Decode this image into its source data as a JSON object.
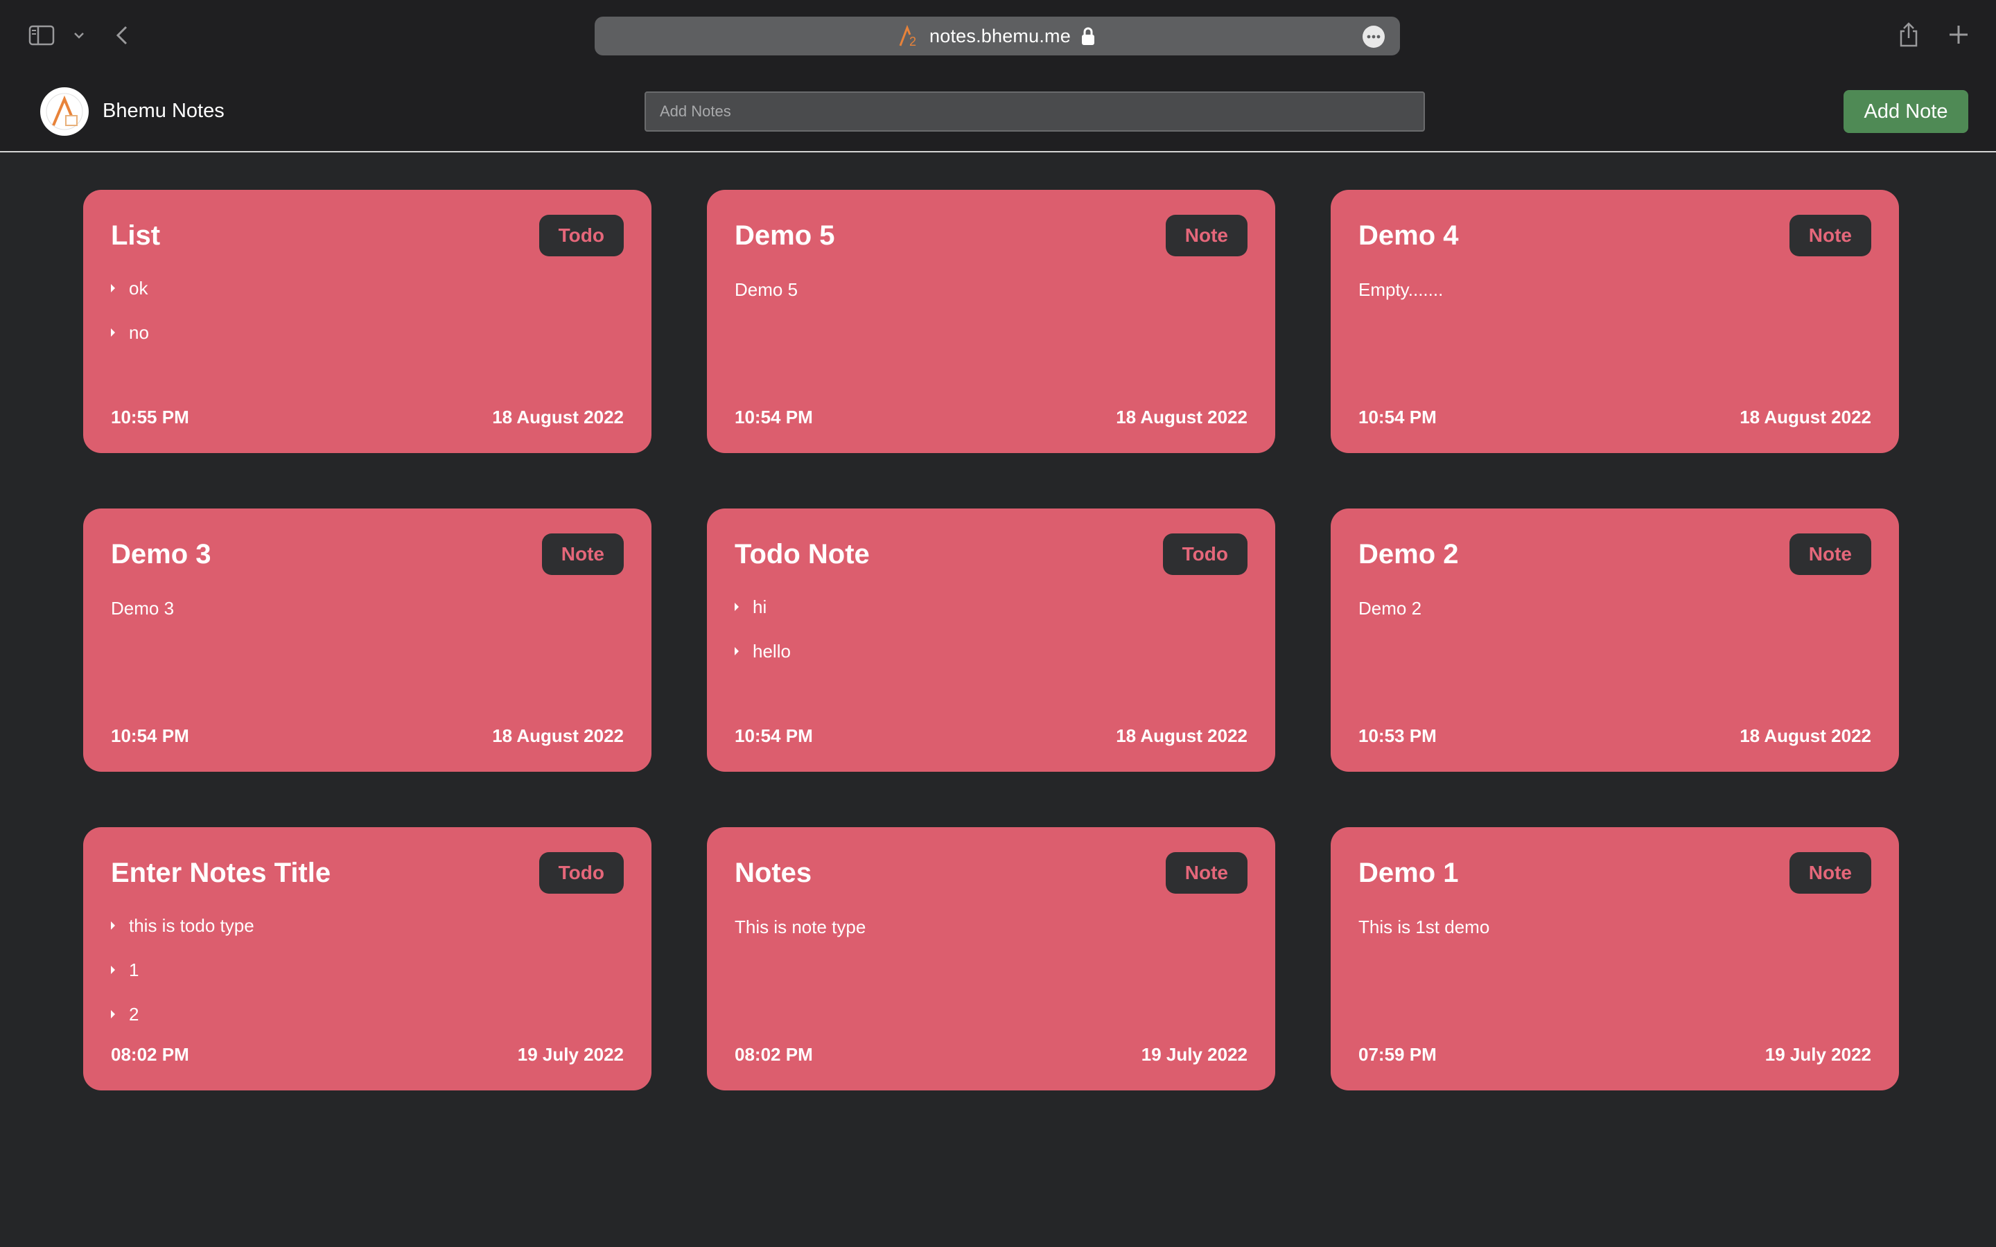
{
  "browser": {
    "url": "notes.bhemu.me"
  },
  "header": {
    "app_name": "Bhemu Notes",
    "search_placeholder": "Add Notes",
    "add_note_label": "Add Note"
  },
  "colors": {
    "card": "#dc5e6e",
    "badge_bg": "#2e2f31",
    "badge_text": "#e5677a",
    "add_button": "#4f8a55",
    "page_bg": "#252628"
  },
  "notes": [
    {
      "title": "List",
      "type": "Todo",
      "items": [
        "ok",
        "no"
      ],
      "body": "",
      "time": "10:55 PM",
      "date": "18 August 2022"
    },
    {
      "title": "Demo 5",
      "type": "Note",
      "items": [],
      "body": "Demo 5",
      "time": "10:54 PM",
      "date": "18 August 2022"
    },
    {
      "title": "Demo 4",
      "type": "Note",
      "items": [],
      "body": "Empty.......",
      "time": "10:54 PM",
      "date": "18 August 2022"
    },
    {
      "title": "Demo 3",
      "type": "Note",
      "items": [],
      "body": "Demo 3",
      "time": "10:54 PM",
      "date": "18 August 2022"
    },
    {
      "title": "Todo Note",
      "type": "Todo",
      "items": [
        "hi",
        "hello"
      ],
      "body": "",
      "time": "10:54 PM",
      "date": "18 August 2022"
    },
    {
      "title": "Demo 2",
      "type": "Note",
      "items": [],
      "body": "Demo 2",
      "time": "10:53 PM",
      "date": "18 August 2022"
    },
    {
      "title": "Enter Notes Title",
      "type": "Todo",
      "items": [
        "this is todo type",
        "1",
        "2"
      ],
      "body": "",
      "time": "08:02 PM",
      "date": "19 July 2022"
    },
    {
      "title": "Notes",
      "type": "Note",
      "items": [],
      "body": "This is note type",
      "time": "08:02 PM",
      "date": "19 July 2022"
    },
    {
      "title": "Demo 1",
      "type": "Note",
      "items": [],
      "body": "This is 1st demo",
      "time": "07:59 PM",
      "date": "19 July 2022"
    }
  ]
}
